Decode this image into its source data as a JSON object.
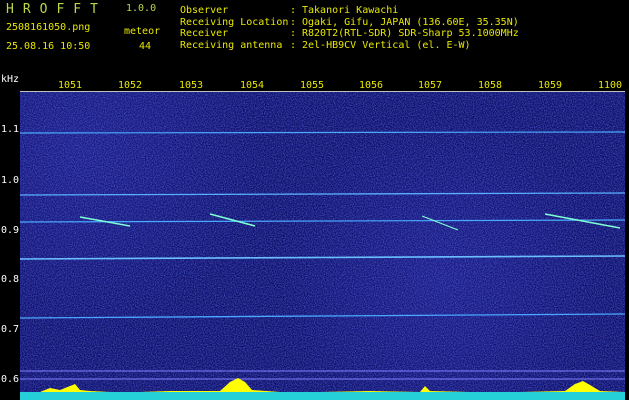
{
  "header": {
    "app_title": "HROFFT",
    "app_version": "1.0.0",
    "file_name": "2508161050.png",
    "date_time": "25.08.16 10:50",
    "meteor_label": "meteor",
    "meteor_count": "44",
    "info": [
      {
        "key": "Observer",
        "sep": ":",
        "value": "Takanori Kawachi"
      },
      {
        "key": "Receiving Location",
        "sep": ":",
        "value": "Ogaki, Gifu, JAPAN (136.60E, 35.35N)"
      },
      {
        "key": "Receiver",
        "sep": ":",
        "value": "R820T2(RTL-SDR) SDR-Sharp 53.1000MHz"
      },
      {
        "key": "Receiving antenna",
        "sep": ":",
        "value": "2el-HB9CV Vertical (el. E-W)"
      }
    ]
  },
  "y_axis": {
    "unit": "kHz",
    "ticks": [
      "1.1",
      "1.0",
      "0.9",
      "0.8",
      "0.7",
      "0.6"
    ]
  },
  "x_axis": {
    "ticks": [
      "1051",
      "1052",
      "1053",
      "1054",
      "1055",
      "1056",
      "1057",
      "1058",
      "1059",
      "1100"
    ]
  },
  "colors": {
    "background": "#0c0c64",
    "header_text": "#e8e800",
    "title_green": "#b8d84a",
    "carrier_lines": "#4aa8ff",
    "spectrum_fill": "#ffff00",
    "baseline": "#00c8ff"
  }
}
